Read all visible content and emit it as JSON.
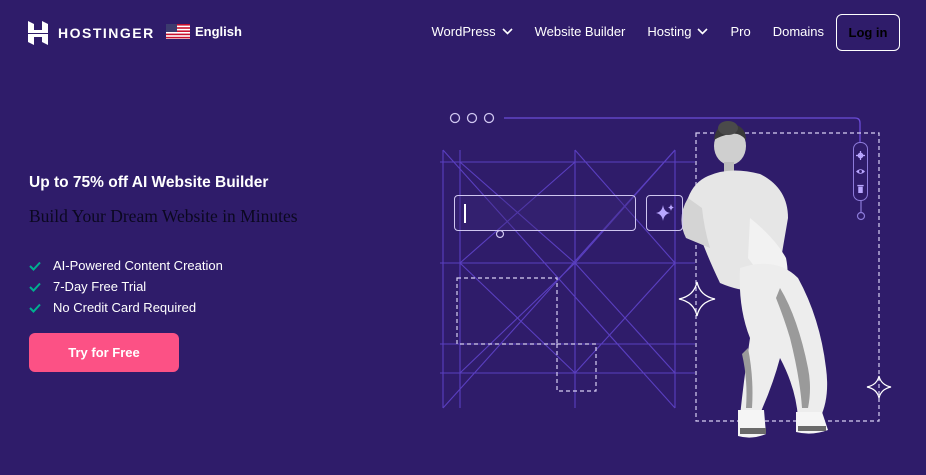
{
  "header": {
    "brand": "HOSTINGER",
    "language": "English",
    "nav": [
      {
        "label": "WordPress",
        "has_dropdown": true
      },
      {
        "label": "Website Builder",
        "has_dropdown": false
      },
      {
        "label": "Hosting",
        "has_dropdown": true
      },
      {
        "label": "Pro",
        "has_dropdown": false
      },
      {
        "label": "Domains",
        "has_dropdown": false
      }
    ],
    "login_label": "Log in"
  },
  "hero": {
    "title": "Up to 75% off AI Website Builder",
    "subtitle": "Build Your Dream Website in Minutes",
    "features": [
      "AI-Powered Content Creation",
      "7-Day Free Trial",
      "No Credit Card Required"
    ],
    "cta_label": "Try for Free"
  },
  "illustration": {
    "toolbar_icons": [
      "gear-icon",
      "eye-icon",
      "trash-icon"
    ],
    "ai_button_icon": "sparkle-icon"
  },
  "colors": {
    "background": "#2f1c6a",
    "cta": "#fc5185",
    "check": "#00b090",
    "grid_line": "#6a4bd6"
  }
}
